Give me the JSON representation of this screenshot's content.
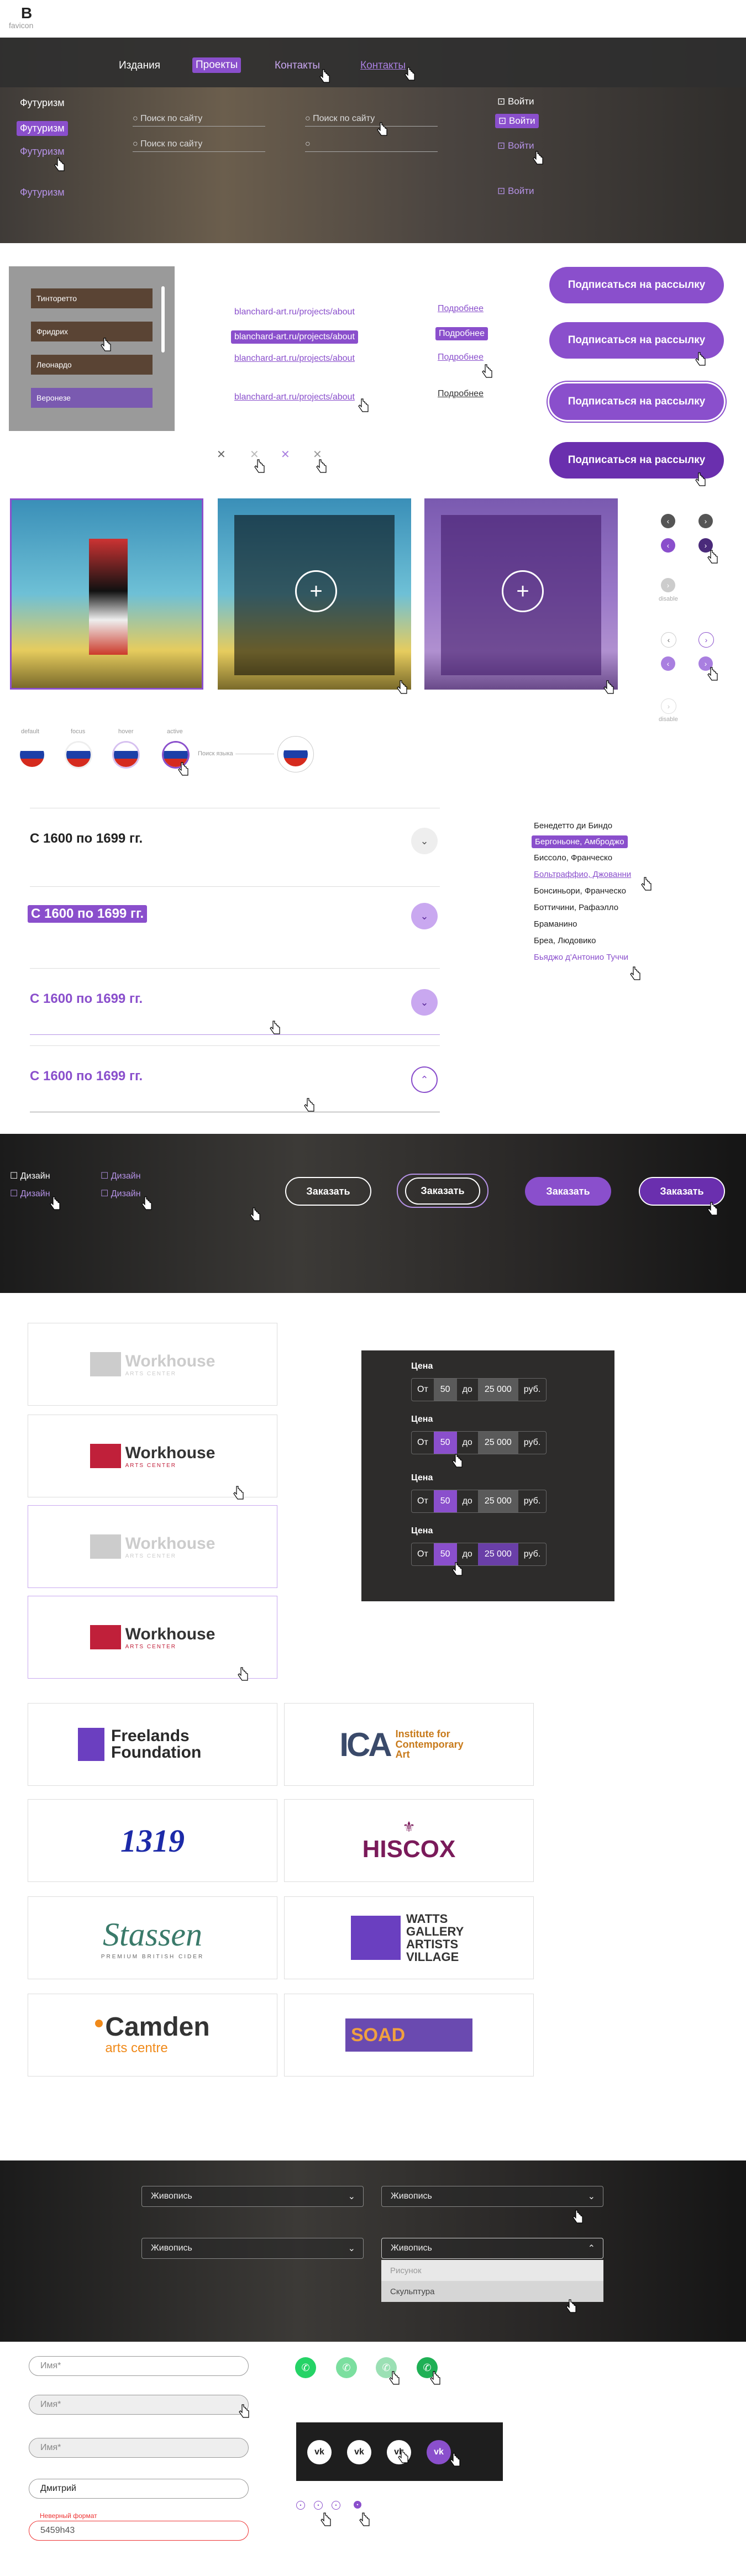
{
  "brand": {
    "logo": "B",
    "caption": "favicon"
  },
  "nav": {
    "items": [
      "Издания",
      "Проекты",
      "Контакты",
      "Контакты"
    ]
  },
  "filters": {
    "futurism": [
      "Футуризм",
      "Футуризм",
      "Футуризм",
      "Футуризм"
    ],
    "search_placeholder": "Поиск по сайту",
    "login": "Войти"
  },
  "artist_list": [
    "Тинторетто",
    "Фридрих",
    "Леонардо",
    "Веронезе"
  ],
  "links": {
    "url": "blanchard-art.ru/projects/about",
    "more": "Подробнее"
  },
  "subscribe": {
    "label": "Подписаться на рассылку"
  },
  "image_cards": {
    "zoom_icon": "+"
  },
  "pagination": {
    "disable": "disable"
  },
  "flags": {
    "states": [
      "default",
      "focus",
      "hover",
      "active"
    ],
    "search_hint": "Поиск языка"
  },
  "accordion": {
    "period": "С 1600 по 1699 гг."
  },
  "artist_names": [
    "Бенедетто ди Биндо",
    "Бергоньоне, Амброджо",
    "Биссоло, Франческо",
    "Больтраффио, Джованни",
    "Бонсиньори, Франческо",
    "Боттичини, Рафаэлло",
    "Браманино",
    "Бреа, Людовико",
    "Бьяджо д'Антонио Туччи"
  ],
  "design_filter": {
    "label": "Дизайн"
  },
  "order": {
    "label": "Заказать"
  },
  "price": {
    "title": "Цена",
    "from": "От",
    "from_val": "50",
    "to": "до",
    "to_val": "25 000",
    "currency": "руб."
  },
  "partners": [
    "Workhouse",
    "ARTS CENTER",
    "Freelands Foundation",
    "Institute for Contemporary Art",
    "1319",
    "HISCOX",
    "Stassen",
    "PREMIUM BRITISH CIDER",
    "WATTS GALLERY ARTISTS VILLAGE",
    "Camden",
    "arts centre",
    "SOAD"
  ],
  "dropdowns": {
    "value": "Живопись",
    "options": [
      "Рисунок",
      "Скульптура"
    ]
  },
  "form": {
    "name_placeholder": "Имя*",
    "name_value": "Дмитрий",
    "error_label": "Неверный формат",
    "phone_value": "5459h43"
  },
  "colors": {
    "accent": "#8a4fcc",
    "whatsapp": "#25d366"
  }
}
